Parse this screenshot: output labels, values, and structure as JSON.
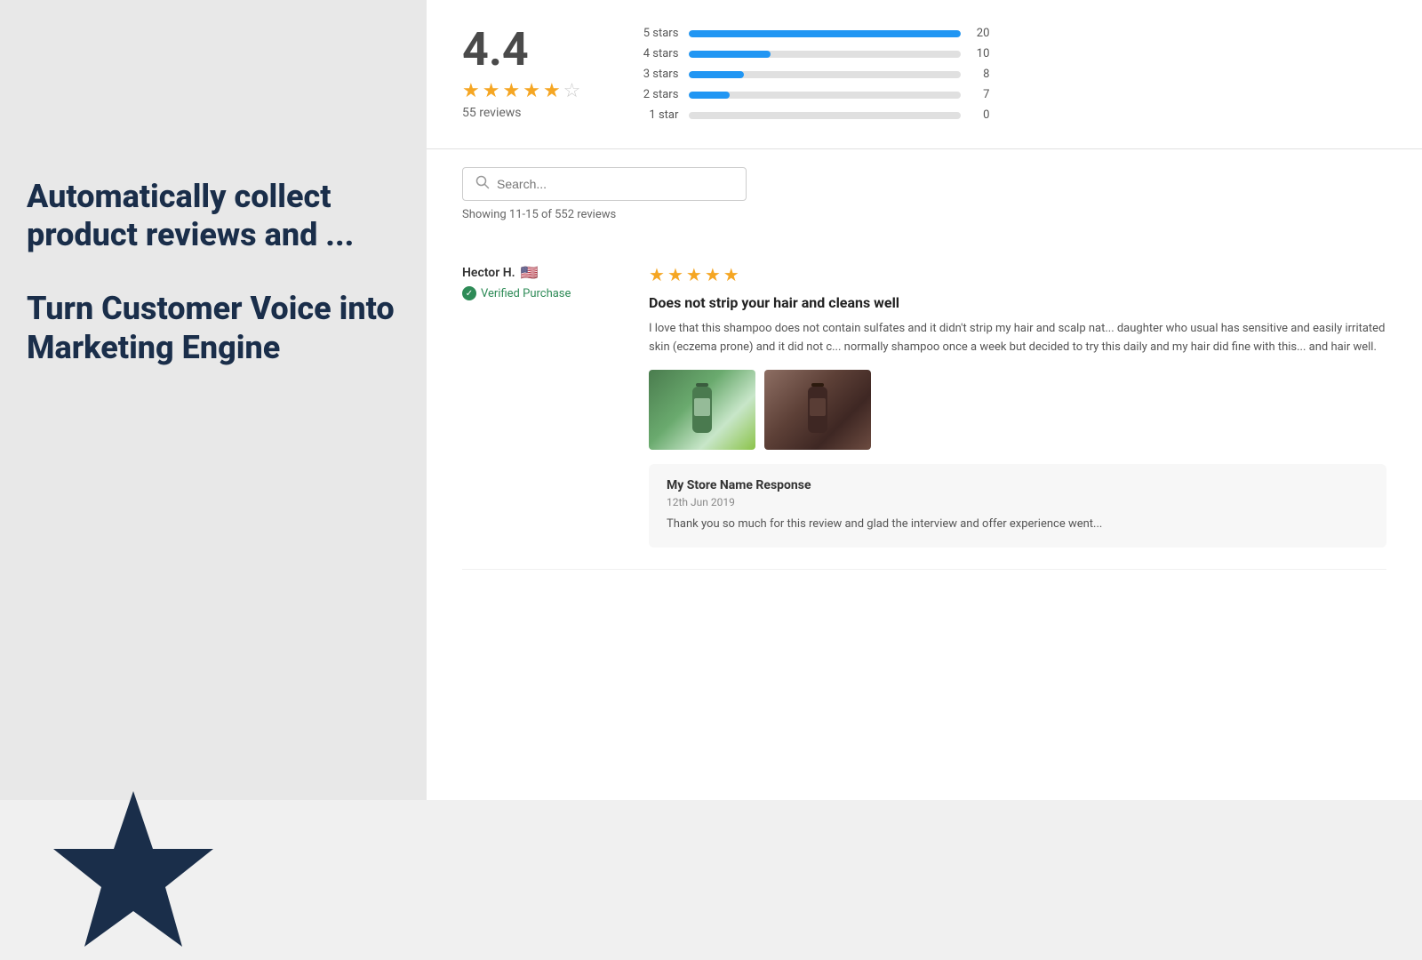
{
  "left": {
    "headline_auto": "Automatically collect\nproduct reviews and ...",
    "headline_turn": "Turn Customer Voice into\nMarketing Engine"
  },
  "right": {
    "rating": {
      "overall": "4.4",
      "review_count": "55 reviews",
      "bars": [
        {
          "label": "5 stars",
          "count": 20,
          "pct": 100
        },
        {
          "label": "4 stars",
          "count": 10,
          "pct": 30
        },
        {
          "label": "3 stars",
          "count": 8,
          "pct": 20
        },
        {
          "label": "2 stars",
          "count": 7,
          "pct": 15
        },
        {
          "label": "1 star",
          "count": 0,
          "pct": 0
        }
      ]
    },
    "search": {
      "placeholder": "Search...",
      "showing_text": "Showing 11-15 of 552 reviews"
    },
    "reviews": [
      {
        "reviewer": "Hector H.",
        "flag": "🇺🇸",
        "verified": "Verified Purchase",
        "stars": 5,
        "title": "Does not strip your hair and cleans well",
        "text": "I love that this shampoo does not contain sulfates and it didn't strip my hair and scalp nat... daughter who usual has sensitive and easily irritated skin (eczema prone) and it did not c... normally shampoo once a week but decided to try this daily and my hair did fine with this... and hair well.",
        "has_images": true
      }
    ],
    "store_response": {
      "title": "My Store Name Response",
      "date": "12th Jun 2019",
      "text": "Thank you so much for this review and glad the interview and offer experience went..."
    }
  }
}
